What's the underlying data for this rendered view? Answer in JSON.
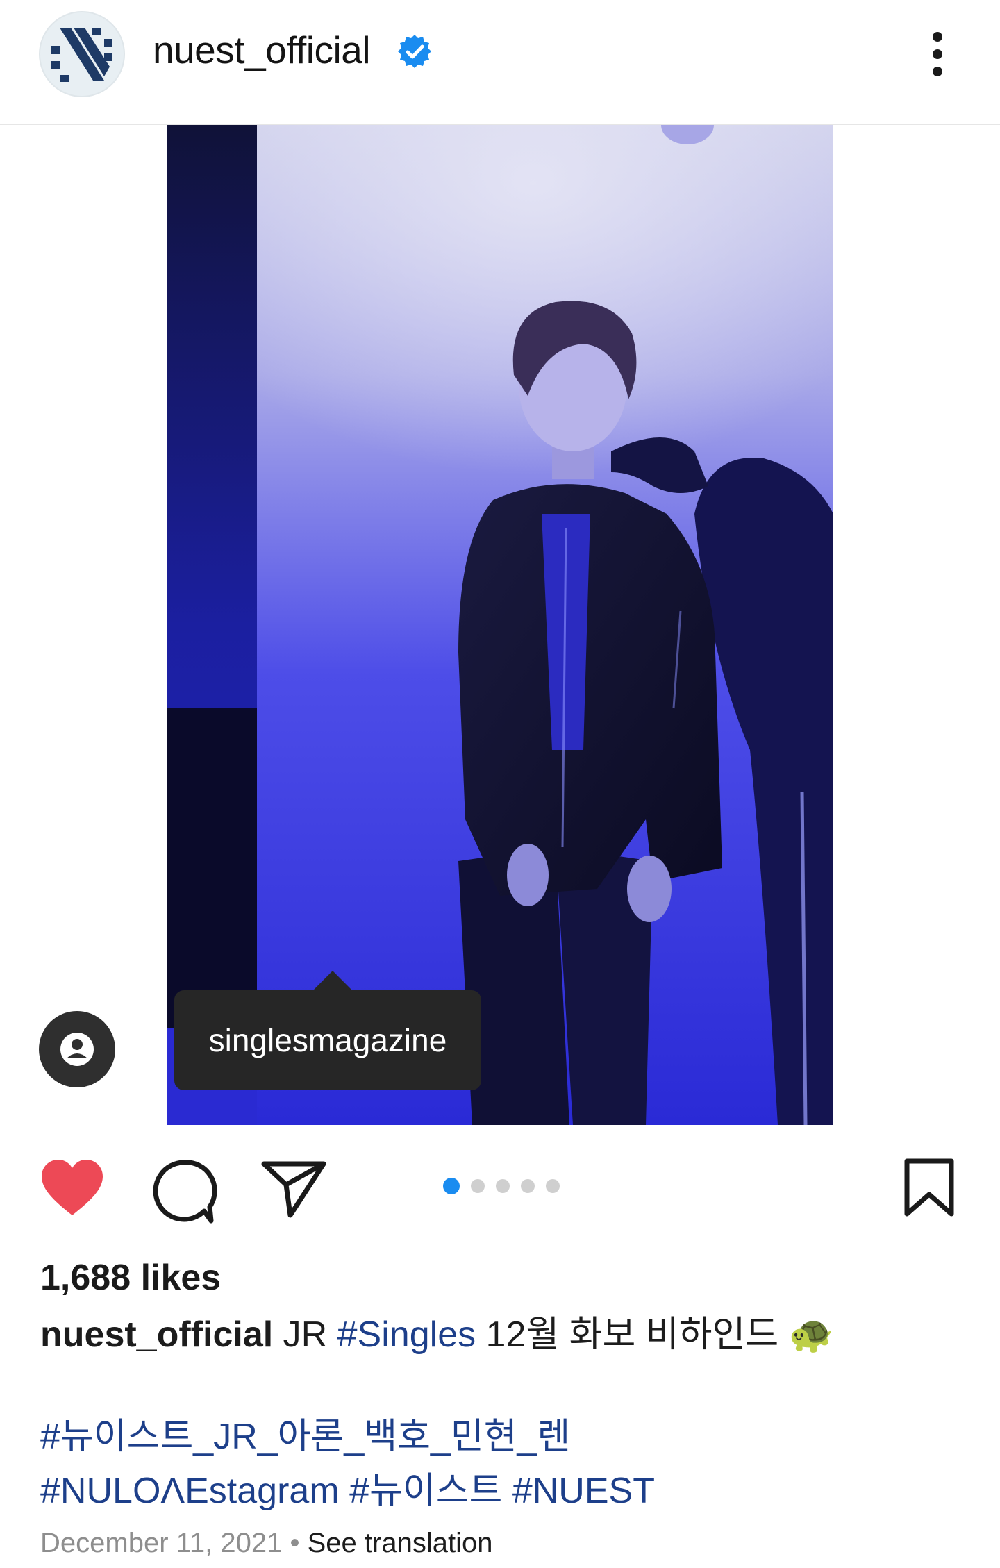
{
  "header": {
    "username": "nuest_official"
  },
  "media": {
    "tagged_user": "singlesmagazine",
    "carousel_count": 5,
    "carousel_active": 1
  },
  "post": {
    "likes": "1,688 likes",
    "caption_user": "nuest_official",
    "caption_prefix": "JR ",
    "caption_tag": "#Singles",
    "caption_text": " 12월 화보 비하인드 🐢",
    "hashtags_line1": "#뉴이스트_JR_아론_백호_민현_렌",
    "hashtags_line2": "#NULOΛEstagram #뉴이스트 #NUEST",
    "date": "December 11, 2021",
    "separator": "•",
    "see_translation": "See translation"
  },
  "colors": {
    "like": "#ed4956",
    "link": "#1d3f8a",
    "active_dot": "#1a8cf0",
    "verified": "#1a8cf0"
  },
  "icons": {
    "like": "heart-icon",
    "comment": "comment-icon",
    "share": "send-icon",
    "save": "bookmark-icon",
    "more": "more-vertical-icon",
    "user_tag": "user-tag-icon"
  }
}
